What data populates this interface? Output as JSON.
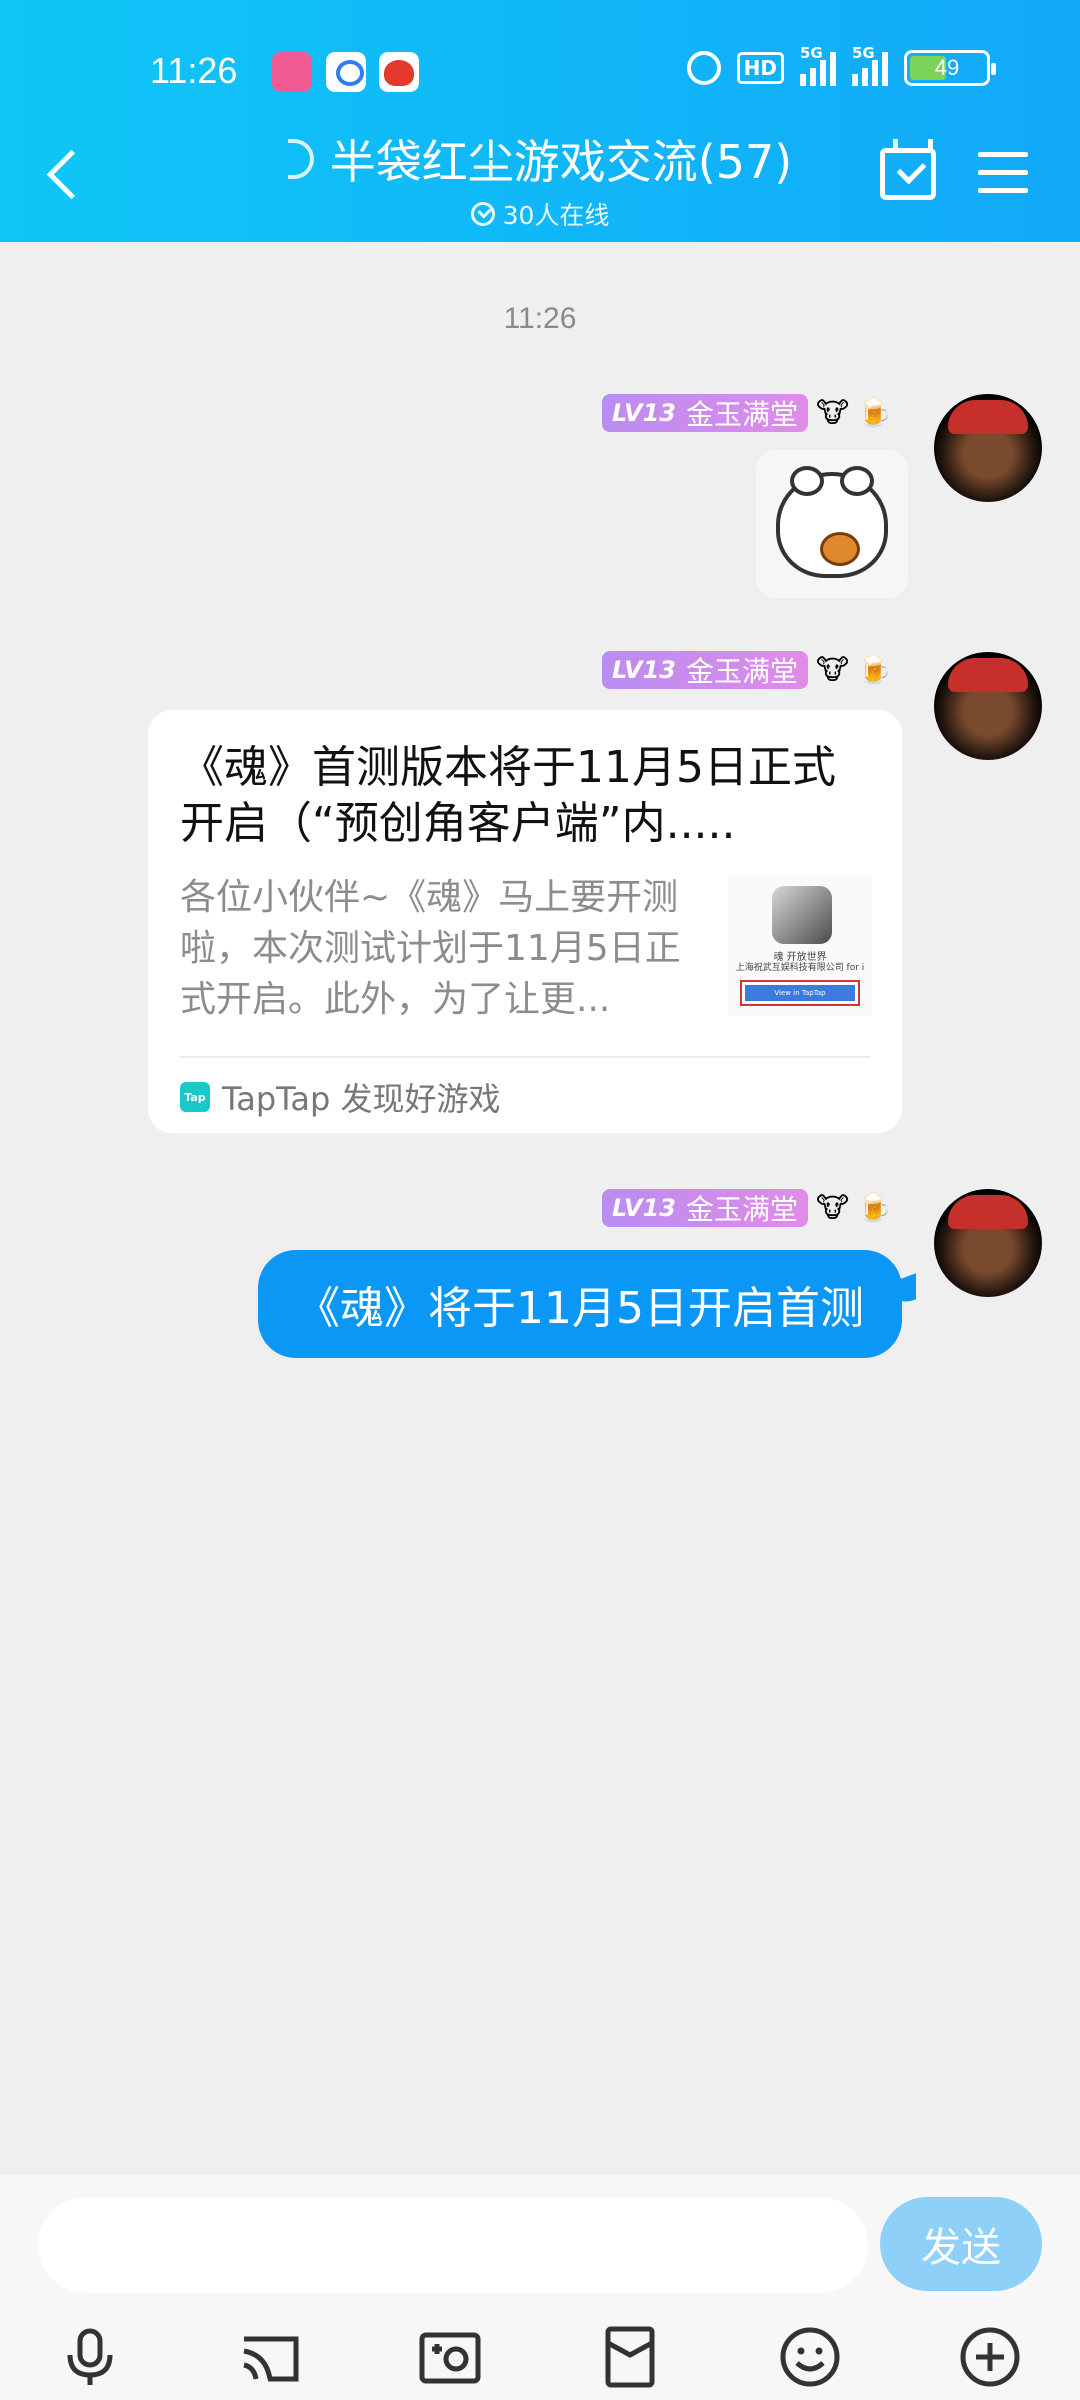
{
  "status_bar": {
    "time": "11:26",
    "network_1": "5G",
    "network_2": "5G",
    "hd_label": "HD",
    "battery": "49"
  },
  "header": {
    "title": "半袋红尘游戏交流(57)",
    "online": "30人在线"
  },
  "chat": {
    "timestamp": "11:26",
    "messages": [
      {
        "sender": {
          "level": "LV13",
          "name": "金玉满堂",
          "emojis": [
            "🐮",
            "🍺"
          ]
        },
        "type": "sticker"
      },
      {
        "sender": {
          "level": "LV13",
          "name": "金玉满堂",
          "emojis": [
            "🐮",
            "🍺"
          ]
        },
        "type": "link_card",
        "card": {
          "title": "《魂》首测版本将于11月5日正式开启（“预创角客户端”内.....",
          "description": "各位小伙伴~《魂》马上要开测啦，本次测试计划于11月5日正式开启。此外，为了让更...",
          "thumb_line1": "魂 开放世界",
          "thumb_line2": "上海祝武互娱科技有限公司 for i",
          "thumb_button": "View in TapTap",
          "source_icon": "Tap",
          "source": "TapTap 发现好游戏"
        }
      },
      {
        "sender": {
          "level": "LV13",
          "name": "金玉满堂",
          "emojis": [
            "🐮",
            "🍺"
          ]
        },
        "type": "text",
        "text": "《魂》将于11月5日开启首测"
      }
    ]
  },
  "input": {
    "placeholder": "",
    "send_label": "发送"
  },
  "toolbar": {
    "icons": [
      "microphone-icon",
      "cast-icon",
      "photo-icon",
      "red-packet-icon",
      "emoji-icon",
      "plus-icon"
    ]
  },
  "colors": {
    "header_gradient_start": "#0fc6f7",
    "header_gradient_end": "#12a9f8",
    "bubble": "#0b97f6",
    "send_button": "#8fd0f8",
    "level_badge": "#c98ded"
  }
}
